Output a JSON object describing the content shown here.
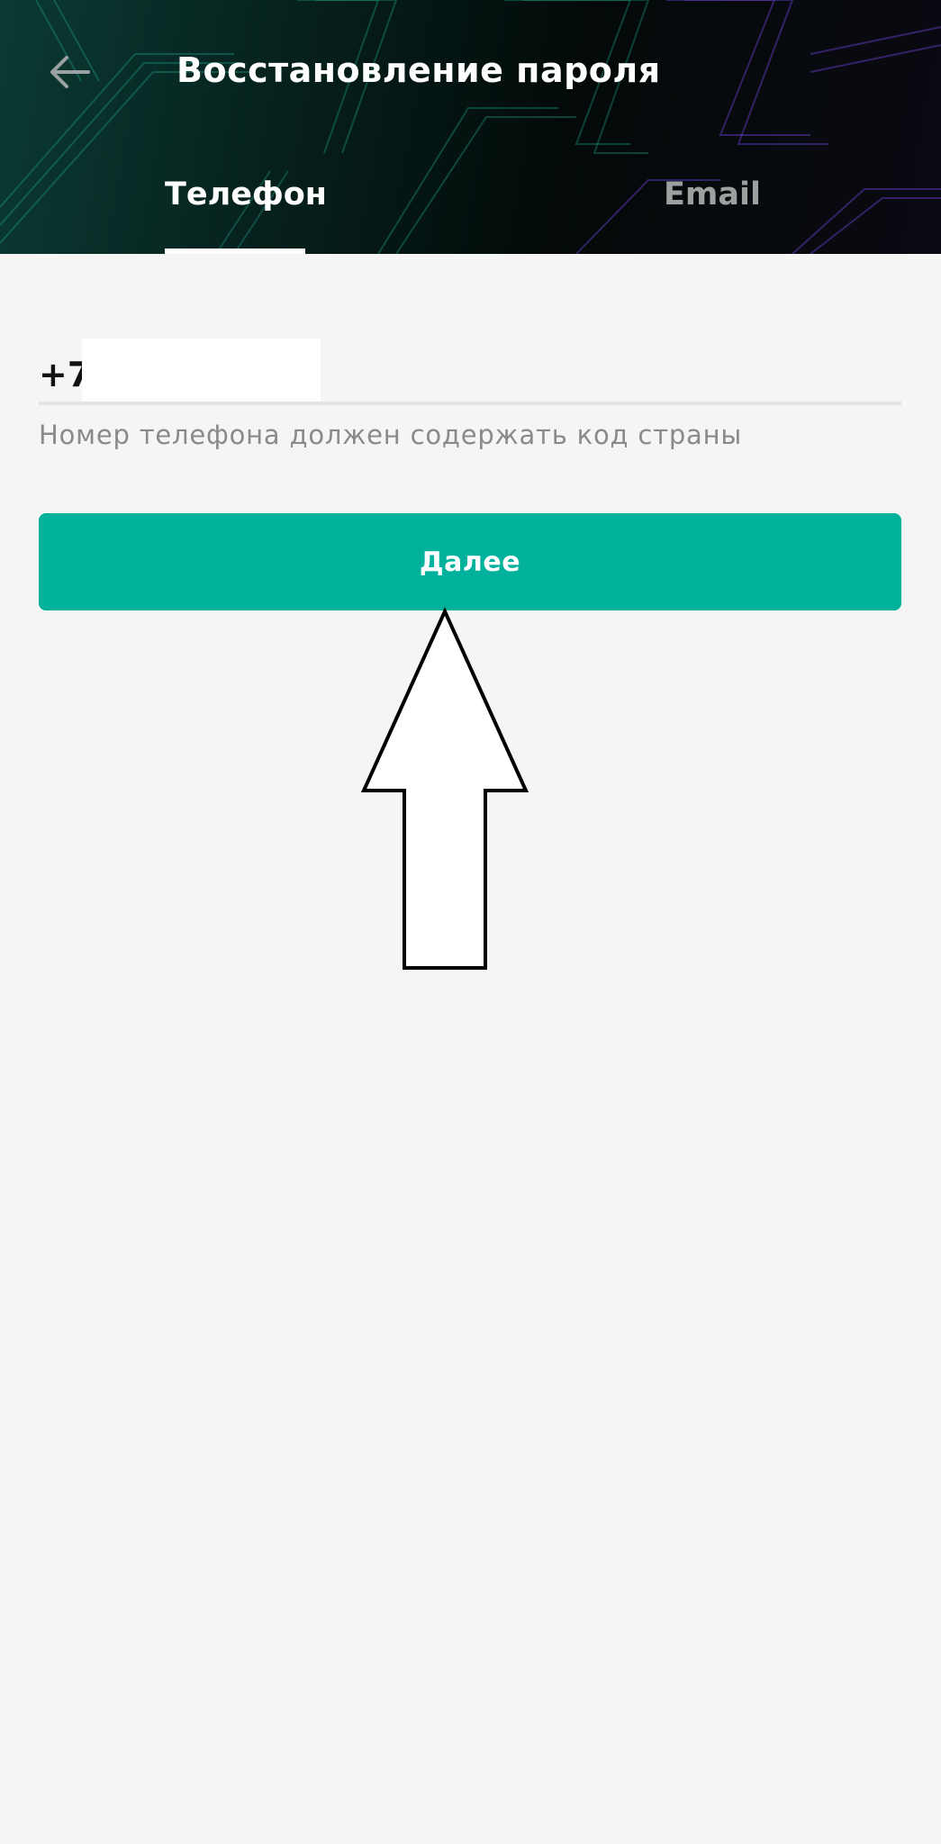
{
  "header": {
    "title": "Восстановление пароля",
    "back_icon": "arrow-left-icon"
  },
  "tabs": [
    {
      "label": "Телефон",
      "active": true
    },
    {
      "label": "Email",
      "active": false
    }
  ],
  "phone": {
    "prefix": "+7",
    "value": "",
    "hint": "Номер телефона должен содержать код страны"
  },
  "actions": {
    "next_label": "Далее"
  },
  "colors": {
    "accent": "#00b29c",
    "background": "#f5f5f5",
    "header_dark": "#030a09"
  },
  "annotation": {
    "icon": "up-arrow-annotation"
  }
}
